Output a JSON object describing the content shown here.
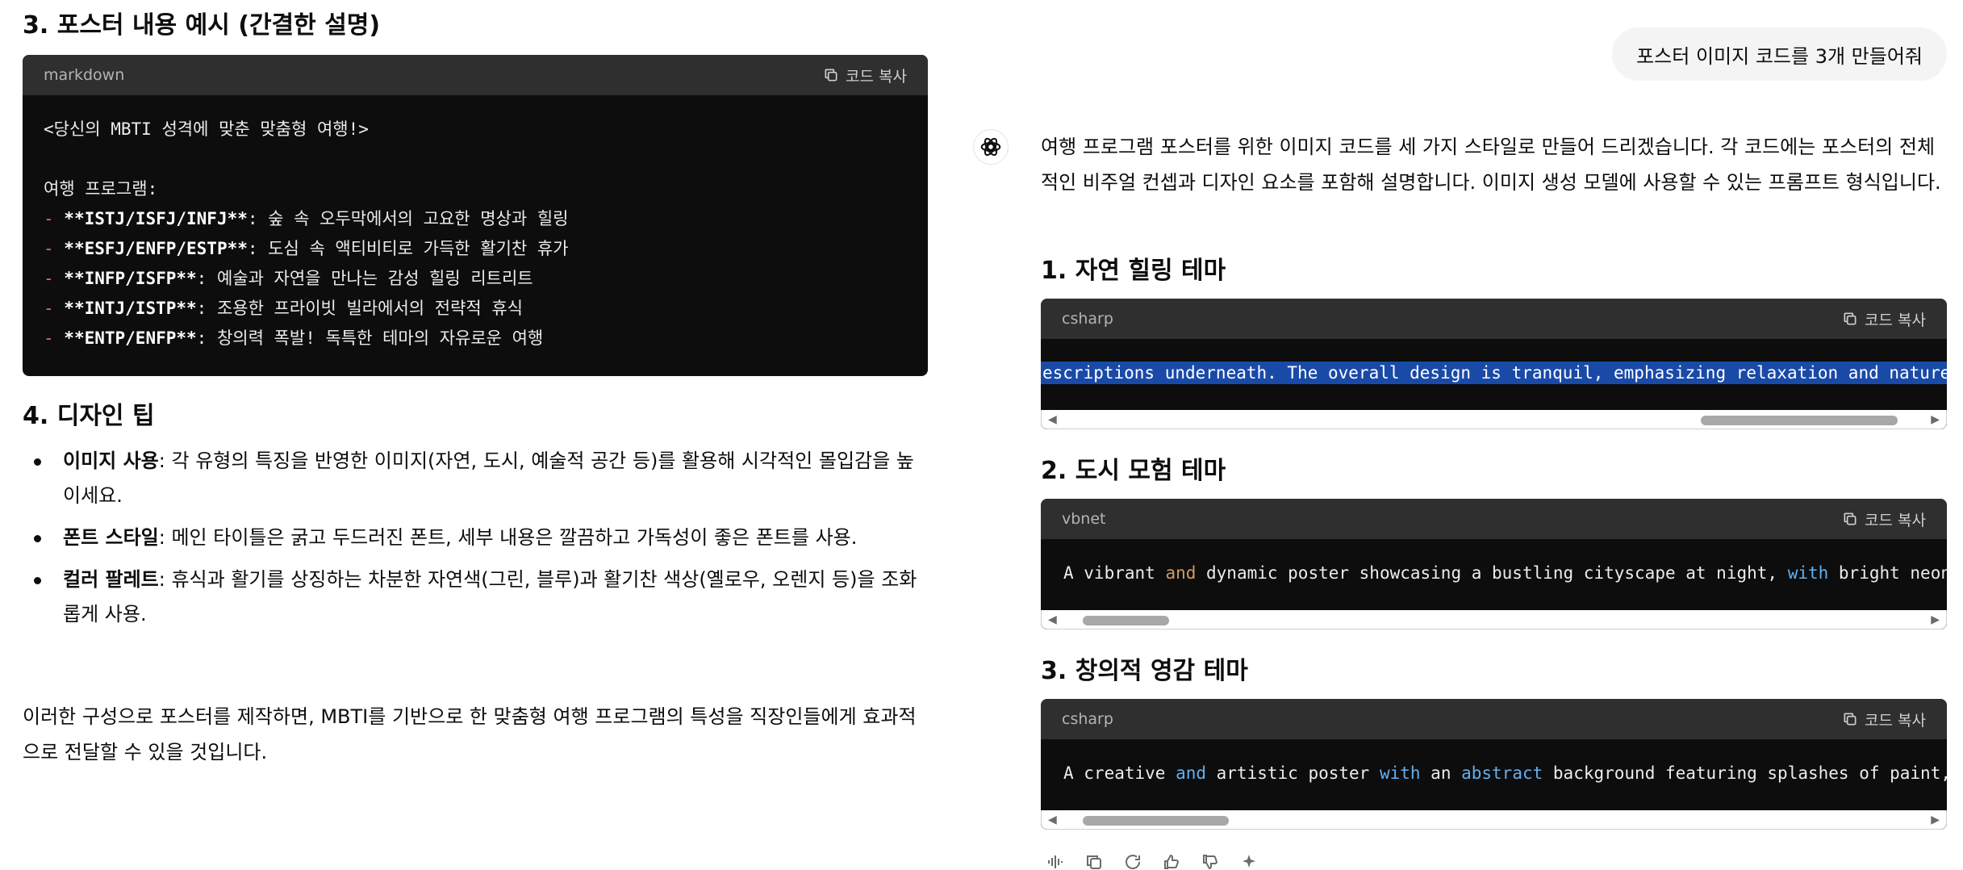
{
  "left": {
    "section3_title": "3. 포스터 내용 예시 (간결한 설명)",
    "code": {
      "lang": "markdown",
      "copy_label": "코드 복사",
      "lines": [
        {
          "dash": "",
          "bold": "",
          "text": "<당신의 MBTI 성격에 맞춘 맞춤형 여행!>"
        },
        {
          "dash": "",
          "bold": "",
          "text": ""
        },
        {
          "dash": "",
          "bold": "",
          "text": "여행 프로그램:"
        },
        {
          "dash": "- ",
          "bold": "**ISTJ/ISFJ/INFJ**",
          "text": ": 숲 속 오두막에서의 고요한 명상과 힐링"
        },
        {
          "dash": "- ",
          "bold": "**ESFJ/ENFP/ESTP**",
          "text": ": 도심 속 액티비티로 가득한 활기찬 휴가"
        },
        {
          "dash": "- ",
          "bold": "**INFP/ISFP**",
          "text": ": 예술과 자연을 만나는 감성 힐링 리트리트"
        },
        {
          "dash": "- ",
          "bold": "**INTJ/ISTP**",
          "text": ": 조용한 프라이빗 빌라에서의 전략적 휴식"
        },
        {
          "dash": "- ",
          "bold": "**ENTP/ENFP**",
          "text": ": 창의력 폭발! 독특한 테마의 자유로운 여행"
        }
      ]
    },
    "section4_title": "4. 디자인 팁",
    "tips": [
      {
        "label": "이미지 사용",
        "text": ": 각 유형의 특징을 반영한 이미지(자연, 도시, 예술적 공간 등)를 활용해 시각적인 몰입감을 높이세요."
      },
      {
        "label": "폰트 스타일",
        "text": ": 메인 타이틀은 굵고 두드러진 폰트, 세부 내용은 깔끔하고 가독성이 좋은 폰트를 사용."
      },
      {
        "label": "컬러 팔레트",
        "text": ": 휴식과 활기를 상징하는 차분한 자연색(그린, 블루)과 활기찬 색상(옐로우, 오렌지 등)을 조화롭게 사용."
      }
    ],
    "closing": "이러한 구성으로 포스터를 제작하면, MBTI를 기반으로 한 맞춤형 여행 프로그램의 특성을 직장인들에게 효과적으로 전달할 수 있을 것입니다."
  },
  "user_message": "포스터 이미지 코드를 3개 만들어줘",
  "assistant": {
    "intro": "여행 프로그램 포스터를 위한 이미지 코드를 세 가지 스타일로 만들어 드리겠습니다. 각 코드에는 포스터의 전체적인 비주얼 컨셉과 디자인 요소를 포함해 설명합니다. 이미지 생성 모델에 사용할 수 있는 프롬프트 형식입니다.",
    "blocks": [
      {
        "title": "1. 자연 힐링 테마",
        "lang": "csharp",
        "copy_label": "코드 복사",
        "tokens": [
          {
            "t": "escriptions underneath. The overall design is tranquil, emphasizing relaxation and nature.",
            "c": "sel"
          }
        ],
        "scroll_thumb": [
          0.74,
          0.97
        ]
      },
      {
        "title": "2. 도시 모험 테마",
        "lang": "vbnet",
        "copy_label": "코드 복사",
        "tokens": [
          {
            "t": "A vibrant ",
            "c": ""
          },
          {
            "t": "and",
            "c": "kw2"
          },
          {
            "t": " dynamic poster showcasing a bustling cityscape at night, ",
            "c": ""
          },
          {
            "t": "with",
            "c": "kw"
          },
          {
            "t": " bright neon lights",
            "c": ""
          }
        ],
        "scroll_thumb": [
          0.02,
          0.12
        ]
      },
      {
        "title": "3. 창의적 영감 테마",
        "lang": "csharp",
        "copy_label": "코드 복사",
        "tokens": [
          {
            "t": "A creative ",
            "c": ""
          },
          {
            "t": "and",
            "c": "kw"
          },
          {
            "t": " artistic poster ",
            "c": ""
          },
          {
            "t": "with",
            "c": "kw"
          },
          {
            "t": " an ",
            "c": ""
          },
          {
            "t": "abstract",
            "c": "kw"
          },
          {
            "t": " background featuring splashes of paint, bold",
            "c": ""
          }
        ],
        "scroll_thumb": [
          0.02,
          0.19
        ]
      }
    ]
  },
  "icons": {
    "avatar": "chatgpt-logo-icon",
    "copy": "copy-icon",
    "actions": [
      "read-aloud-icon",
      "copy-icon",
      "regenerate-icon",
      "thumbs-up-icon",
      "thumbs-down-icon",
      "sparkle-icon"
    ]
  }
}
